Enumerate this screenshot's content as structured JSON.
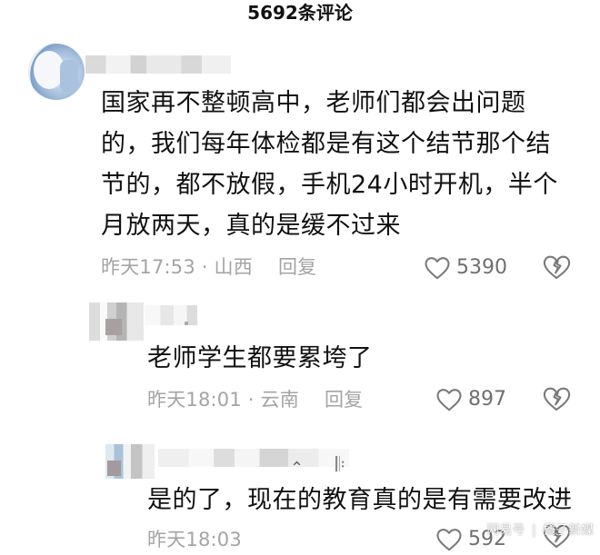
{
  "header": {
    "title": "5692条评论"
  },
  "comment_main": {
    "text": "国家再不整顿高中，老师们都会出问题\n的，我们每年体检都是有这个结节那个结\n节的，都不放假，手机24小时开机，半个\n月放两天，真的是缓不过来",
    "time_location": "昨天17:53 · 山西",
    "reply_label": "回复",
    "likes": "5390"
  },
  "reply_1": {
    "text": "老师学生都要累垮了",
    "time_location": "昨天18:01 · 云南",
    "reply_label": "回复",
    "likes": "897"
  },
  "reply_2": {
    "text": "是的了，现在的教育真的是有需要改进",
    "time_location": "昨天18:03",
    "reply_label": "",
    "likes": "592"
  },
  "watermark": {
    "left": "网易号",
    "right": "橘子新媒"
  },
  "icons": {
    "like": "heart-outline-icon",
    "dislike": "broken-heart-icon"
  },
  "colors": {
    "text_primary": "#111111",
    "text_secondary": "#a4a4a4",
    "icon": "#7a7a7a"
  }
}
